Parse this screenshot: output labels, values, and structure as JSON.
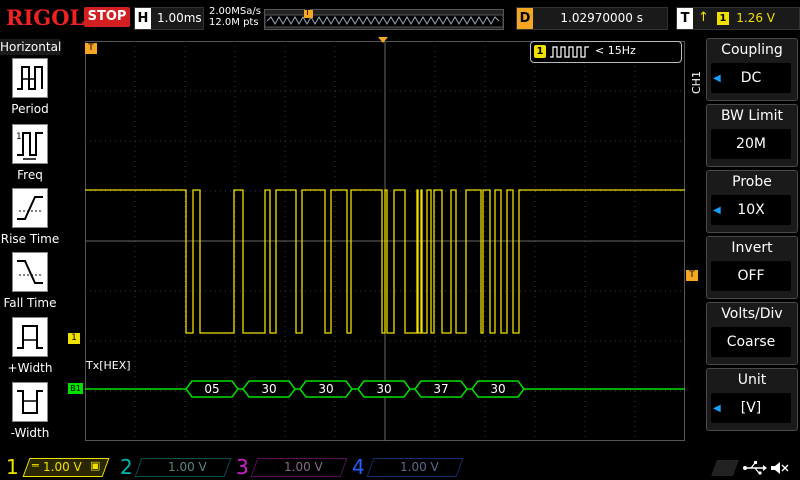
{
  "brand": "RIGOL",
  "status": "STOP",
  "horizontal": {
    "label": "H",
    "timebase": "1.00ms"
  },
  "acquisition": {
    "sample_rate": "2.00MSa/s",
    "memory_depth": "12.0M pts"
  },
  "memory_marker": "T",
  "delay": {
    "label": "D",
    "value": "1.02970000 s"
  },
  "trigger": {
    "label": "T",
    "source": "1",
    "level": "1.26 V"
  },
  "left_menu": {
    "title": "Horizontal",
    "items": [
      {
        "label": "Period",
        "icon": "period-icon"
      },
      {
        "label": "Freq",
        "icon": "frequency-icon"
      },
      {
        "label": "Rise Time",
        "icon": "rise-time-icon"
      },
      {
        "label": "Fall Time",
        "icon": "fall-time-icon"
      },
      {
        "label": "+Width",
        "icon": "positive-width-icon"
      },
      {
        "label": "-Width",
        "icon": "negative-width-icon"
      }
    ]
  },
  "freq_counter": {
    "channel": "1",
    "text": "< 15Hz"
  },
  "decode": {
    "label": "Tx[HEX]",
    "marker": "B1",
    "bytes": [
      "05",
      "30",
      "30",
      "30",
      "37",
      "30"
    ]
  },
  "markers": {
    "trigger_time": "T",
    "channel1_ground": "1",
    "trigger_level": "T"
  },
  "right_menu": {
    "tab": "CH1",
    "items": [
      {
        "title": "Coupling",
        "value": "DC",
        "has_arrow": true
      },
      {
        "title": "BW Limit",
        "value": "20M",
        "has_arrow": false
      },
      {
        "title": "Probe",
        "value": "10X",
        "has_arrow": true
      },
      {
        "title": "Invert",
        "value": "OFF",
        "has_arrow": false
      },
      {
        "title": "Volts/Div",
        "value": "Coarse",
        "has_arrow": false
      },
      {
        "title": "Unit",
        "value": "[V]",
        "has_arrow": true
      }
    ]
  },
  "channels": [
    {
      "number": "1",
      "scale": "1.00 V",
      "color": "#f0e000",
      "active": true
    },
    {
      "number": "2",
      "scale": "1.00 V",
      "color": "#00b8b0",
      "active": false
    },
    {
      "number": "3",
      "scale": "1.00 V",
      "color": "#d020d0",
      "active": false
    },
    {
      "number": "4",
      "scale": "1.00 V",
      "color": "#2060ff",
      "active": false
    }
  ],
  "colors": {
    "ch1": "#f0e000",
    "decode": "#00e000",
    "trigger": "#f5a623",
    "stop": "#d21f1f",
    "arrow": "#18a0ff"
  }
}
